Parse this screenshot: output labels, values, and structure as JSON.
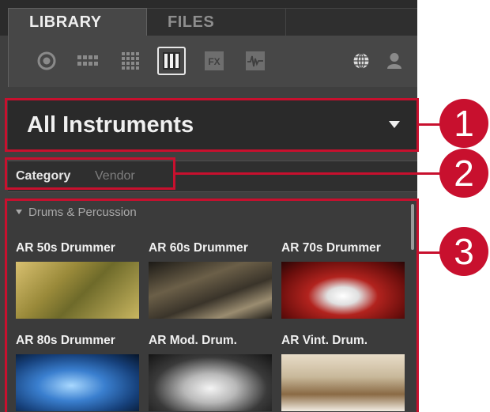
{
  "tabs": {
    "library": "LIBRARY",
    "files": "FILES"
  },
  "icons": [
    "all-content-icon",
    "groups-icon",
    "sounds-icon",
    "instruments-icon",
    "effects-icon",
    "samples-icon",
    "globe-icon",
    "user-icon"
  ],
  "icons_fx_text": "FX",
  "dropdown": {
    "label": "All Instruments"
  },
  "filters": {
    "category": "Category",
    "vendor": "Vendor"
  },
  "results": {
    "group": "Drums & Percussion",
    "items": [
      {
        "label": "AR 50s Drummer"
      },
      {
        "label": "AR 60s Drummer"
      },
      {
        "label": "AR 70s Drummer"
      },
      {
        "label": "AR 80s Drummer"
      },
      {
        "label": "AR Mod. Drum."
      },
      {
        "label": "AR Vint. Drum."
      }
    ]
  },
  "callouts": [
    "1",
    "2",
    "3"
  ],
  "colors": {
    "callout": "#c8102e",
    "panel": "#3f3f3f",
    "dark": "#2a2a2a"
  }
}
